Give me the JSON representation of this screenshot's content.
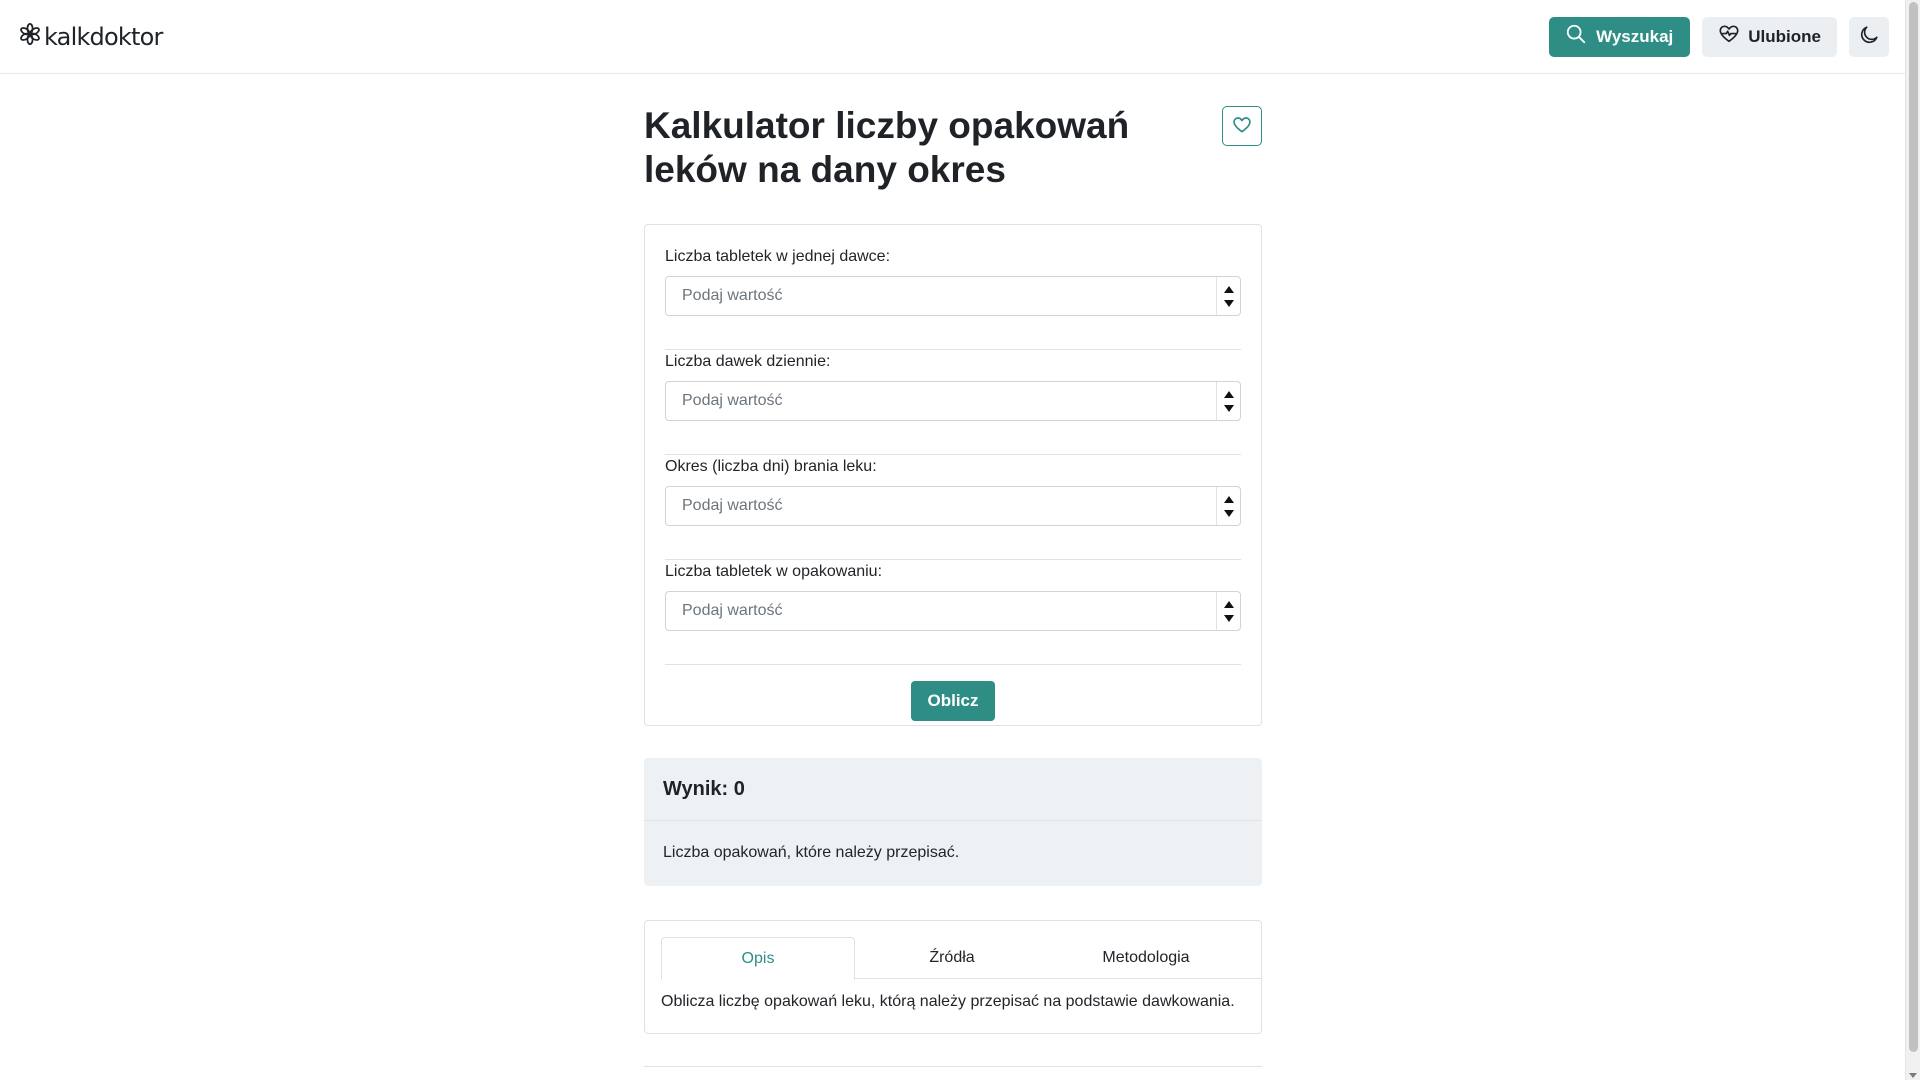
{
  "header": {
    "logo_text": "kalkdoktor",
    "search_label": "Wyszukaj",
    "favorites_label": "Ulubione",
    "icons": {
      "logo": "asterisk-flower-icon",
      "search": "search-icon",
      "favorites": "heart-pulse-icon",
      "theme": "moon-icon"
    }
  },
  "page": {
    "title": "Kalkulator liczby opakowań leków na dany okres"
  },
  "form": {
    "fields": [
      {
        "label": "Liczba tabletek w jednej dawce:",
        "placeholder": "Podaj wartość",
        "value": ""
      },
      {
        "label": "Liczba dawek dziennie:",
        "placeholder": "Podaj wartość",
        "value": ""
      },
      {
        "label": "Okres (liczba dni) brania leku:",
        "placeholder": "Podaj wartość",
        "value": ""
      },
      {
        "label": "Liczba tabletek w opakowaniu:",
        "placeholder": "Podaj wartość",
        "value": ""
      }
    ],
    "submit_label": "Oblicz"
  },
  "result": {
    "heading": "Wynik: 0",
    "description": "Liczba opakowań, które należy przepisać."
  },
  "tabs": {
    "items": [
      {
        "label": "Opis",
        "active": true
      },
      {
        "label": "Źródła",
        "active": false
      },
      {
        "label": "Metodologia",
        "active": false
      }
    ],
    "active_content": "Oblicza liczbę opakowań leku, którą należy przepisać na podstawie dawkowania."
  },
  "colors": {
    "accent": "#2e8e86",
    "result_bg": "#edf1f4",
    "button_secondary_bg": "#eceff1"
  }
}
